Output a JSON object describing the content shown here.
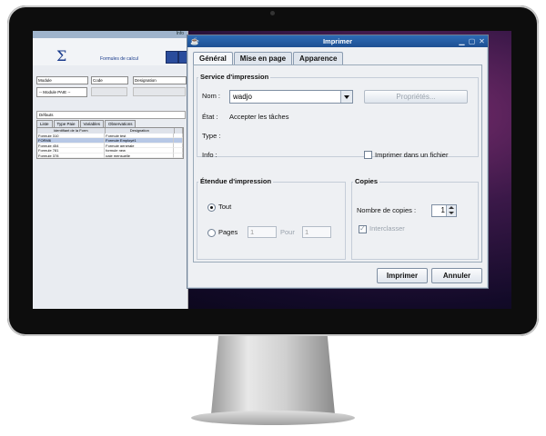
{
  "background_app": {
    "window_title": "Info",
    "header_title": "Formules de calcul",
    "labels": {
      "module": "Module",
      "code": "Code",
      "designation": "Designation"
    },
    "module_select": "-- Module PAIE --",
    "field_value": "Défauts",
    "tabs": [
      "Liste",
      "Type Paie",
      "Variables",
      "Observations"
    ],
    "table": {
      "headers": [
        "Identifiant de la Form",
        "Designation"
      ],
      "rows": [
        [
          "Formule 310",
          "Formule test"
        ],
        [
          "FORM6",
          "Formule Employé1"
        ],
        [
          "Formule 454",
          "Formule generale"
        ],
        [
          "Formule 781",
          "formule new"
        ],
        [
          "Formule 378",
          "paie mensuelle"
        ]
      ],
      "selected_row": 1
    }
  },
  "dialog": {
    "title": "Imprimer",
    "tabs": [
      "Général",
      "Mise en page",
      "Apparence"
    ],
    "active_tab": 0,
    "print_service": {
      "group_title": "Service d'impression",
      "name_label": "Nom :",
      "name_value": "wadjo",
      "properties_button": "Propriétés...",
      "state_label": "État :",
      "state_value": "Accepter les tâches",
      "type_label": "Type :",
      "info_label": "Info :",
      "print_to_file_label": "Imprimer dans un fichier"
    },
    "print_range": {
      "group_title": "Étendue d'impression",
      "all_label": "Tout",
      "pages_label": "Pages",
      "from_value": "1",
      "to_label": "Pour",
      "to_value": "1"
    },
    "copies": {
      "group_title": "Copies",
      "count_label": "Nombre de copies :",
      "count_value": "1",
      "collate_label": "Interclasser"
    },
    "buttons": {
      "print": "Imprimer",
      "cancel": "Annuler"
    }
  },
  "colors": {
    "titlebar": "#2d6bb5",
    "screen_background": "#3a1848"
  }
}
